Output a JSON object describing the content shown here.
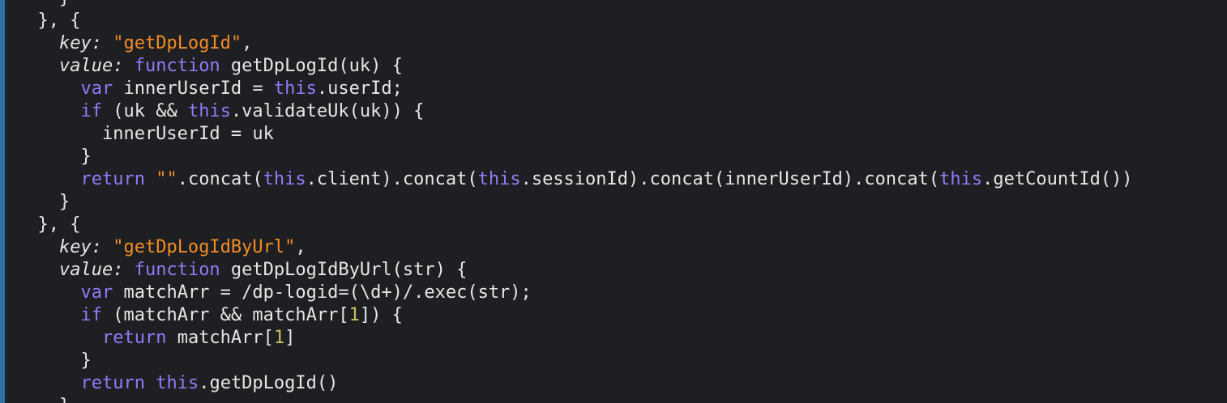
{
  "colors": {
    "background": "#1e1f22",
    "gutter_bar": "#2f6fa6",
    "keyword": "#8d7cf6",
    "string": "#f28c28",
    "number": "#c9c35a",
    "text": "#e6e6e6"
  },
  "lines": [
    [
      {
        "t": "plain",
        "v": "    }"
      }
    ],
    [
      {
        "t": "plain",
        "v": "  }, {"
      }
    ],
    [
      {
        "t": "plain",
        "v": "    "
      },
      {
        "t": "prop",
        "v": "key:"
      },
      {
        "t": "plain",
        "v": " "
      },
      {
        "t": "str",
        "v": "\"getDpLogId\""
      },
      {
        "t": "plain",
        "v": ","
      }
    ],
    [
      {
        "t": "plain",
        "v": "    "
      },
      {
        "t": "prop",
        "v": "value:"
      },
      {
        "t": "plain",
        "v": " "
      },
      {
        "t": "kw",
        "v": "function"
      },
      {
        "t": "plain",
        "v": " getDpLogId(uk) {"
      }
    ],
    [
      {
        "t": "plain",
        "v": "      "
      },
      {
        "t": "kw",
        "v": "var"
      },
      {
        "t": "plain",
        "v": " innerUserId = "
      },
      {
        "t": "this",
        "v": "this"
      },
      {
        "t": "plain",
        "v": ".userId;"
      }
    ],
    [
      {
        "t": "plain",
        "v": "      "
      },
      {
        "t": "kw",
        "v": "if"
      },
      {
        "t": "plain",
        "v": " (uk && "
      },
      {
        "t": "this",
        "v": "this"
      },
      {
        "t": "plain",
        "v": ".validateUk(uk)) {"
      }
    ],
    [
      {
        "t": "plain",
        "v": "        innerUserId = uk"
      }
    ],
    [
      {
        "t": "plain",
        "v": "      }"
      }
    ],
    [
      {
        "t": "plain",
        "v": "      "
      },
      {
        "t": "kw",
        "v": "return"
      },
      {
        "t": "plain",
        "v": " "
      },
      {
        "t": "str",
        "v": "\"\""
      },
      {
        "t": "plain",
        "v": ".concat("
      },
      {
        "t": "this",
        "v": "this"
      },
      {
        "t": "plain",
        "v": ".client).concat("
      },
      {
        "t": "this",
        "v": "this"
      },
      {
        "t": "plain",
        "v": ".sessionId).concat(innerUserId).concat("
      },
      {
        "t": "this",
        "v": "this"
      },
      {
        "t": "plain",
        "v": ".getCountId())"
      }
    ],
    [
      {
        "t": "plain",
        "v": "    }"
      }
    ],
    [
      {
        "t": "plain",
        "v": "  }, {"
      }
    ],
    [
      {
        "t": "plain",
        "v": "    "
      },
      {
        "t": "prop",
        "v": "key:"
      },
      {
        "t": "plain",
        "v": " "
      },
      {
        "t": "str",
        "v": "\"getDpLogIdByUrl\""
      },
      {
        "t": "plain",
        "v": ","
      }
    ],
    [
      {
        "t": "plain",
        "v": "    "
      },
      {
        "t": "prop",
        "v": "value:"
      },
      {
        "t": "plain",
        "v": " "
      },
      {
        "t": "kw",
        "v": "function"
      },
      {
        "t": "plain",
        "v": " getDpLogIdByUrl(str) {"
      }
    ],
    [
      {
        "t": "plain",
        "v": "      "
      },
      {
        "t": "kw",
        "v": "var"
      },
      {
        "t": "plain",
        "v": " matchArr = /dp-logid=(\\d+)/.exec(str);"
      }
    ],
    [
      {
        "t": "plain",
        "v": "      "
      },
      {
        "t": "kw",
        "v": "if"
      },
      {
        "t": "plain",
        "v": " (matchArr && matchArr["
      },
      {
        "t": "num",
        "v": "1"
      },
      {
        "t": "plain",
        "v": "]) {"
      }
    ],
    [
      {
        "t": "plain",
        "v": "        "
      },
      {
        "t": "kw",
        "v": "return"
      },
      {
        "t": "plain",
        "v": " matchArr["
      },
      {
        "t": "num",
        "v": "1"
      },
      {
        "t": "plain",
        "v": "]"
      }
    ],
    [
      {
        "t": "plain",
        "v": "      }"
      }
    ],
    [
      {
        "t": "plain",
        "v": "      "
      },
      {
        "t": "kw",
        "v": "return"
      },
      {
        "t": "plain",
        "v": " "
      },
      {
        "t": "this",
        "v": "this"
      },
      {
        "t": "plain",
        "v": ".getDpLogId()"
      }
    ],
    [
      {
        "t": "plain",
        "v": "    }"
      }
    ]
  ]
}
